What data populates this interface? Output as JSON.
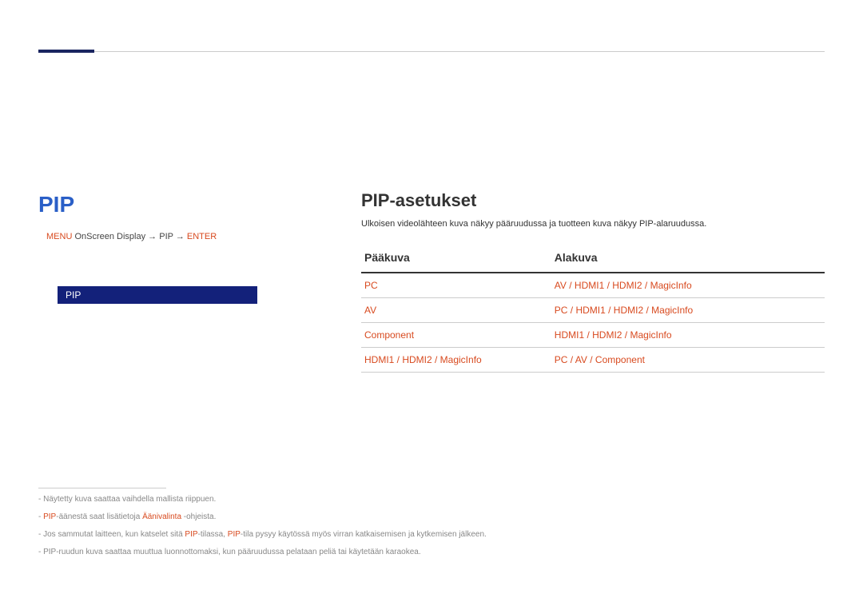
{
  "left": {
    "heading": "PIP",
    "breadcrumb_prefix": "MENU",
    "breadcrumb_item1": "OnScreen Display",
    "breadcrumb_arrow": " → ",
    "breadcrumb_item2": "PIP",
    "breadcrumb_arrow2": " → ",
    "breadcrumb_item3": "ENTER",
    "selected": "PIP"
  },
  "right": {
    "heading": "PIP-asetukset",
    "desc": "Ulkoisen videolähteen kuva näkyy pääruudussa ja tuotteen kuva näkyy PIP-alaruudussa.",
    "col1": "Pääkuva",
    "col2": "Alakuva",
    "rows": [
      {
        "p": "PC",
        "a": "AV / HDMI1 / HDMI2 / MagicInfo"
      },
      {
        "p": "AV",
        "a": "PC / HDMI1 / HDMI2 / MagicInfo"
      },
      {
        "p": "Component",
        "a": "HDMI1 / HDMI2 / MagicInfo"
      },
      {
        "p": "HDMI1 / HDMI2 / MagicInfo",
        "a": "PC / AV / Component"
      }
    ]
  },
  "footnotes": {
    "n1": "Näytetty kuva saattaa vaihdella mallista riippuen.",
    "n2a": "PIP",
    "n2b": "-äänestä saat lisätietoja ",
    "n2c": "Äänivalinta",
    "n2d": " -ohjeista.",
    "n3a": "Jos sammutat laitteen, kun katselet sitä ",
    "n3b": "PIP",
    "n3c": "-tilassa, ",
    "n3d": "PIP",
    "n3e": "-tila pysyy käytössä myös virran katkaisemisen ja kytkemisen jälkeen.",
    "n4": "PIP-ruudun kuva saattaa muuttua luonnottomaksi, kun pääruudussa pelataan peliä tai käytetään karaokea."
  }
}
